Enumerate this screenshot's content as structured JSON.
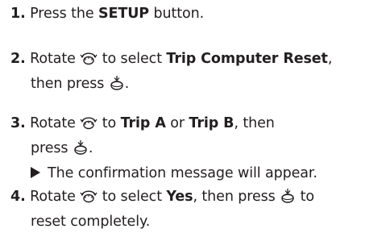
{
  "steps": [
    {
      "number": "1.",
      "text_before": "Press the ",
      "bold": "SETUP",
      "text_after": " button."
    },
    {
      "number": "2.",
      "rotate": "Rotate ",
      "mid": " to select ",
      "bold": "Trip Computer Reset",
      "comma": ",",
      "then_press": "then press ",
      "period": "."
    },
    {
      "number": "3.",
      "rotate": "Rotate ",
      "mid": " to ",
      "bold_a": "Trip A",
      "or": " or ",
      "bold_b": "Trip B",
      "then": ", then",
      "press": "press ",
      "period": ".",
      "note": "The confirmation message will appear."
    },
    {
      "number": "4.",
      "rotate": "Rotate ",
      "mid": " to select ",
      "bold": "Yes",
      "then_press": ", then press ",
      "to": " to",
      "line2": "reset completely."
    }
  ],
  "icons": {
    "rotate": "selector-knob-rotate-icon",
    "press": "selector-knob-press-icon",
    "note": "arrow-right-icon"
  }
}
